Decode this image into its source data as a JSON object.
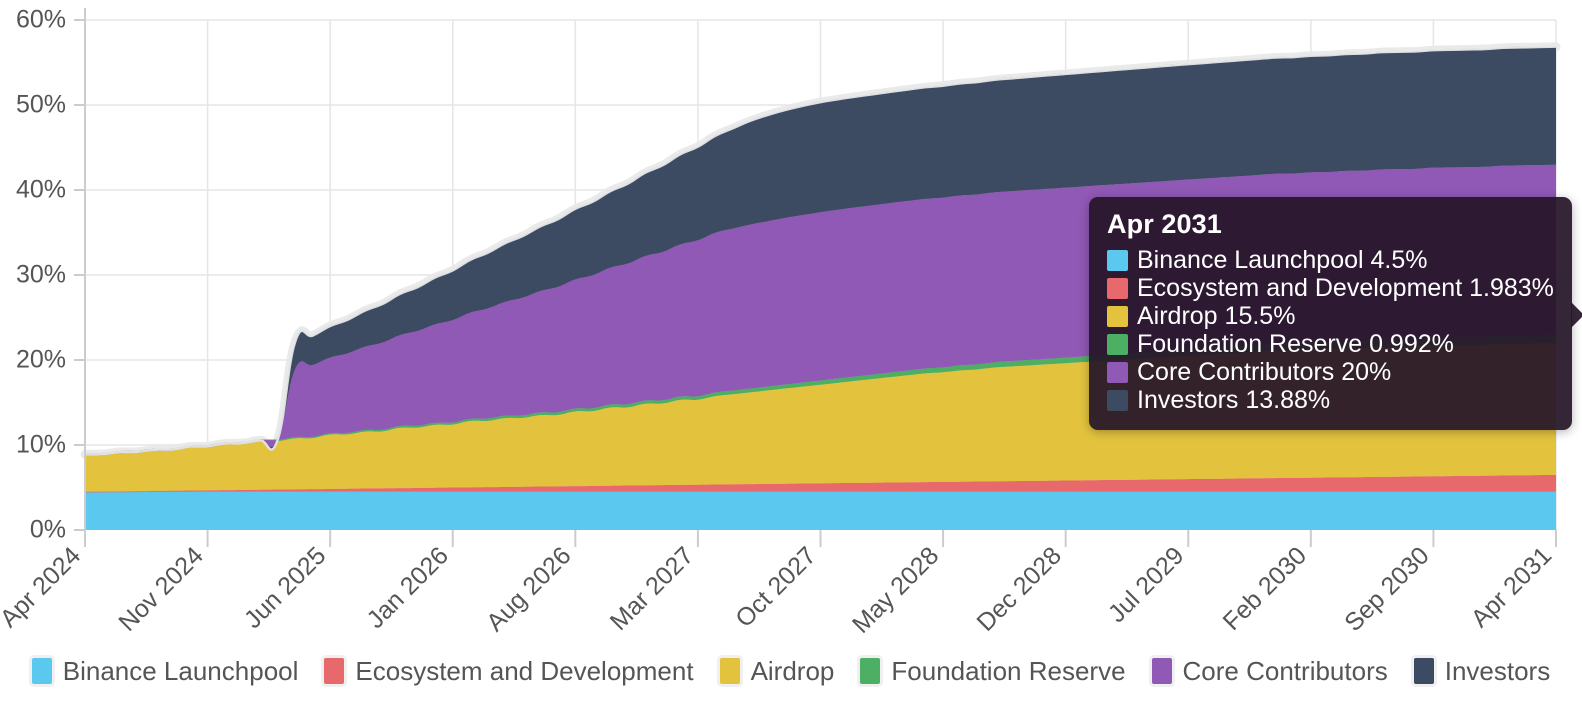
{
  "chart_data": {
    "type": "area",
    "stacked": true,
    "title": "",
    "xlabel": "",
    "ylabel": "",
    "ylim": [
      0,
      60
    ],
    "y_unit": "%",
    "grid": true,
    "legend_position": "bottom",
    "y_ticks": [
      "0%",
      "10%",
      "20%",
      "30%",
      "40%",
      "50%",
      "60%"
    ],
    "y_tick_values": [
      0,
      10,
      20,
      30,
      40,
      50,
      60
    ],
    "x_ticks": [
      "Apr 2024",
      "Nov 2024",
      "Jun 2025",
      "Jan 2026",
      "Aug 2026",
      "Mar 2027",
      "Oct 2027",
      "May 2028",
      "Dec 2028",
      "Jul 2029",
      "Feb 2030",
      "Sep 2030",
      "Apr 2031"
    ],
    "x_tick_index": [
      0,
      7,
      14,
      21,
      28,
      35,
      42,
      49,
      56,
      63,
      70,
      77,
      84
    ],
    "x_months": 85,
    "series": [
      {
        "name": "Binance Launchpool",
        "color": "#5bc8f0",
        "values": [
          4.5,
          4.5,
          4.5,
          4.5,
          4.5,
          4.5,
          4.5,
          4.5,
          4.5,
          4.5,
          4.5,
          4.5,
          4.5,
          4.5,
          4.5,
          4.5,
          4.5,
          4.5,
          4.5,
          4.5,
          4.5,
          4.5,
          4.5,
          4.5,
          4.5,
          4.5,
          4.5,
          4.5,
          4.5,
          4.5,
          4.5,
          4.5,
          4.5,
          4.5,
          4.5,
          4.5,
          4.5,
          4.5,
          4.5,
          4.5,
          4.5,
          4.5,
          4.5,
          4.5,
          4.5,
          4.5,
          4.5,
          4.5,
          4.5,
          4.5,
          4.5,
          4.5,
          4.5,
          4.5,
          4.5,
          4.5,
          4.5,
          4.5,
          4.5,
          4.5,
          4.5,
          4.5,
          4.5,
          4.5,
          4.5,
          4.5,
          4.5,
          4.5,
          4.5,
          4.5,
          4.5,
          4.5,
          4.5,
          4.5,
          4.5,
          4.5,
          4.5,
          4.5,
          4.5,
          4.5,
          4.5,
          4.5,
          4.5,
          4.5,
          4.5
        ]
      },
      {
        "name": "Ecosystem and Development",
        "color": "#e8696b",
        "values": [
          0.0,
          0.024,
          0.047,
          0.071,
          0.094,
          0.118,
          0.142,
          0.165,
          0.189,
          0.212,
          0.236,
          0.26,
          0.283,
          0.307,
          0.33,
          0.354,
          0.378,
          0.401,
          0.425,
          0.448,
          0.472,
          0.496,
          0.519,
          0.543,
          0.566,
          0.59,
          0.614,
          0.637,
          0.661,
          0.684,
          0.708,
          0.732,
          0.755,
          0.779,
          0.802,
          0.826,
          0.85,
          0.873,
          0.897,
          0.92,
          0.944,
          0.968,
          0.991,
          1.015,
          1.038,
          1.062,
          1.086,
          1.109,
          1.133,
          1.156,
          1.18,
          1.204,
          1.227,
          1.251,
          1.274,
          1.298,
          1.322,
          1.345,
          1.369,
          1.392,
          1.416,
          1.44,
          1.463,
          1.487,
          1.51,
          1.534,
          1.558,
          1.581,
          1.605,
          1.628,
          1.652,
          1.676,
          1.699,
          1.723,
          1.746,
          1.77,
          1.794,
          1.817,
          1.841,
          1.864,
          1.888,
          1.912,
          1.935,
          1.959,
          1.983
        ]
      },
      {
        "name": "Airdrop",
        "color": "#e3c33e",
        "values": [
          4.4,
          4.4,
          4.6,
          4.6,
          4.8,
          4.8,
          5.1,
          5.1,
          5.4,
          5.4,
          5.7,
          5.7,
          6.0,
          6.0,
          6.4,
          6.4,
          6.7,
          6.7,
          7.1,
          7.1,
          7.4,
          7.4,
          7.8,
          7.8,
          8.1,
          8.1,
          8.4,
          8.4,
          8.8,
          8.8,
          9.2,
          9.2,
          9.6,
          9.6,
          10.0,
          10.0,
          10.4,
          10.6,
          10.8,
          11.0,
          11.2,
          11.4,
          11.6,
          11.8,
          12.0,
          12.2,
          12.4,
          12.6,
          12.8,
          12.9,
          13.1,
          13.2,
          13.4,
          13.5,
          13.6,
          13.7,
          13.8,
          13.9,
          14.0,
          14.1,
          14.2,
          14.3,
          14.4,
          14.5,
          14.6,
          14.7,
          14.8,
          14.9,
          15.0,
          15.0,
          15.1,
          15.1,
          15.2,
          15.2,
          15.3,
          15.3,
          15.3,
          15.4,
          15.4,
          15.4,
          15.4,
          15.5,
          15.5,
          15.5,
          15.5
        ]
      },
      {
        "name": "Foundation Reserve",
        "color": "#4caf64",
        "values": [
          0.0,
          0.012,
          0.024,
          0.035,
          0.047,
          0.059,
          0.071,
          0.083,
          0.094,
          0.106,
          0.118,
          0.13,
          0.142,
          0.153,
          0.165,
          0.177,
          0.189,
          0.201,
          0.212,
          0.224,
          0.236,
          0.248,
          0.26,
          0.271,
          0.283,
          0.295,
          0.307,
          0.319,
          0.33,
          0.342,
          0.354,
          0.366,
          0.378,
          0.389,
          0.401,
          0.413,
          0.425,
          0.437,
          0.448,
          0.46,
          0.472,
          0.484,
          0.496,
          0.507,
          0.519,
          0.531,
          0.543,
          0.555,
          0.566,
          0.578,
          0.59,
          0.602,
          0.614,
          0.625,
          0.637,
          0.649,
          0.661,
          0.673,
          0.684,
          0.696,
          0.708,
          0.72,
          0.732,
          0.743,
          0.755,
          0.767,
          0.779,
          0.791,
          0.802,
          0.814,
          0.826,
          0.838,
          0.85,
          0.861,
          0.873,
          0.885,
          0.897,
          0.909,
          0.92,
          0.932,
          0.944,
          0.956,
          0.968,
          0.979,
          0.992
        ]
      },
      {
        "name": "Core Contributors",
        "color": "#9059b5",
        "values": [
          0.0,
          0.0,
          0.0,
          0.0,
          0.0,
          0.0,
          0.0,
          0.0,
          0.0,
          0.0,
          0.0,
          0.0,
          8.0,
          8.45,
          8.9,
          9.35,
          9.8,
          10.25,
          10.7,
          11.15,
          11.6,
          12.05,
          12.5,
          12.95,
          13.4,
          13.85,
          14.3,
          14.75,
          15.2,
          15.65,
          16.1,
          16.55,
          17.0,
          17.45,
          17.9,
          18.35,
          18.8,
          19.05,
          19.3,
          19.45,
          19.6,
          19.7,
          19.8,
          19.85,
          19.9,
          19.92,
          19.94,
          19.95,
          19.96,
          19.97,
          19.98,
          19.98,
          19.99,
          19.99,
          20.0,
          20.0,
          20.0,
          20.0,
          20.0,
          20.0,
          20.0,
          20.0,
          20.0,
          20.0,
          20.0,
          20.0,
          20.0,
          20.0,
          20.0,
          20.0,
          20.0,
          20.0,
          20.0,
          20.0,
          20.0,
          20.0,
          20.0,
          20.0,
          20.0,
          20.0,
          20.0,
          20.0,
          20.0,
          20.0,
          20.0
        ]
      },
      {
        "name": "Investors",
        "color": "#3c4b61",
        "values": [
          0.0,
          0.0,
          0.0,
          0.0,
          0.0,
          0.0,
          0.0,
          0.0,
          0.0,
          0.0,
          0.0,
          0.0,
          3.2,
          3.45,
          3.7,
          3.95,
          4.25,
          4.55,
          4.85,
          5.15,
          5.5,
          5.85,
          6.2,
          6.55,
          6.9,
          7.25,
          7.6,
          7.95,
          8.3,
          8.65,
          9.0,
          9.4,
          9.8,
          10.2,
          10.6,
          11.0,
          11.4,
          11.8,
          12.2,
          12.5,
          12.7,
          12.85,
          12.95,
          13.0,
          13.02,
          13.05,
          13.08,
          13.1,
          13.13,
          13.16,
          13.19,
          13.22,
          13.25,
          13.28,
          13.31,
          13.34,
          13.37,
          13.4,
          13.43,
          13.46,
          13.49,
          13.52,
          13.55,
          13.57,
          13.59,
          13.61,
          13.63,
          13.65,
          13.67,
          13.69,
          13.71,
          13.73,
          13.75,
          13.77,
          13.79,
          13.8,
          13.81,
          13.82,
          13.83,
          13.84,
          13.85,
          13.86,
          13.87,
          13.875,
          13.88
        ]
      }
    ]
  },
  "legend": {
    "items": [
      {
        "label": "Binance Launchpool",
        "color": "#5bc8f0"
      },
      {
        "label": "Ecosystem and Development",
        "color": "#e8696b"
      },
      {
        "label": "Airdrop",
        "color": "#e3c33e"
      },
      {
        "label": "Foundation Reserve",
        "color": "#4caf64"
      },
      {
        "label": "Core Contributors",
        "color": "#9059b5"
      },
      {
        "label": "Investors",
        "color": "#3c4b61"
      }
    ]
  },
  "tooltip": {
    "title": "Apr 2031",
    "rows": [
      {
        "label": "Binance Launchpool 4.5%",
        "color": "#5bc8f0"
      },
      {
        "label": "Ecosystem and Development 1.983%",
        "color": "#e8696b"
      },
      {
        "label": "Airdrop 15.5%",
        "color": "#e3c33e"
      },
      {
        "label": "Foundation Reserve 0.992%",
        "color": "#4caf64"
      },
      {
        "label": "Core Contributors 20%",
        "color": "#9059b5"
      },
      {
        "label": "Investors 13.88%",
        "color": "#3c4b61"
      }
    ]
  }
}
